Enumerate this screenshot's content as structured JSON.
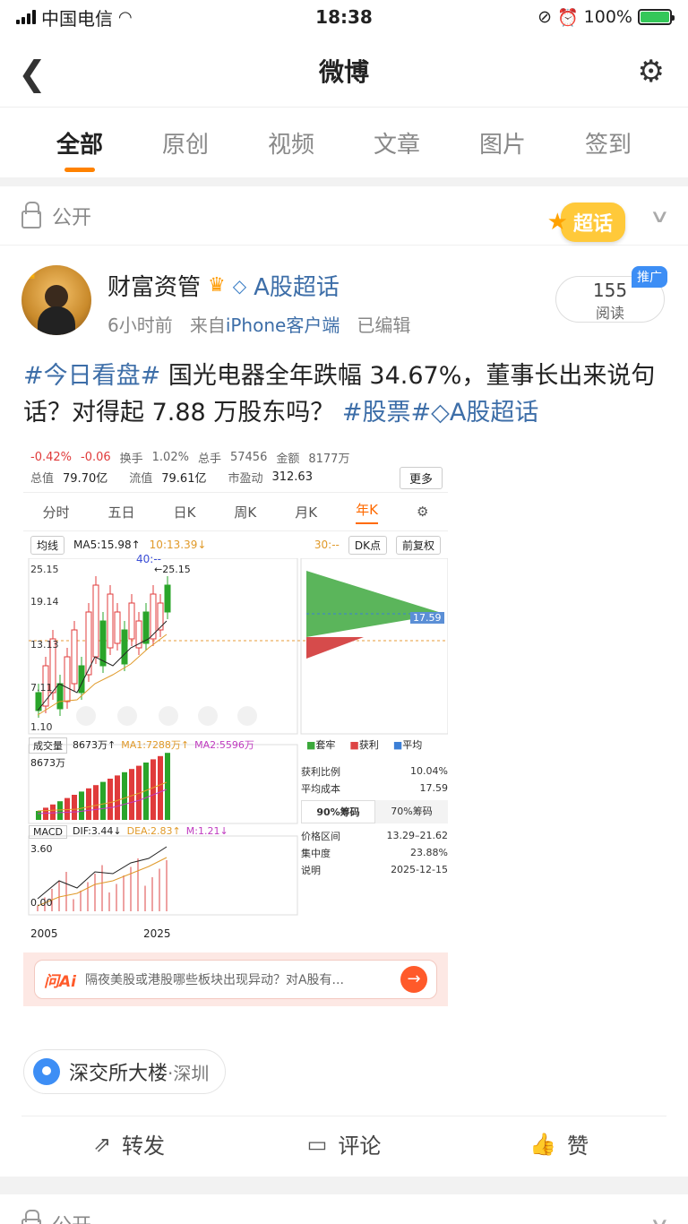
{
  "status": {
    "carrier": "中国电信",
    "time": "18:38",
    "battery": "100%"
  },
  "nav": {
    "title": "微博"
  },
  "tabs": [
    "全部",
    "原创",
    "视频",
    "文章",
    "图片",
    "签到"
  ],
  "visibility": {
    "label": "公开",
    "badge": "超话"
  },
  "post": {
    "author": "财富资管",
    "topic": "A股超话",
    "time": "6小时前",
    "from_prefix": "来自",
    "client": "iPhone客户端",
    "edited": "已编辑",
    "reads": "155",
    "reads_label": "阅读",
    "promo": "推广",
    "text_hash1": "#今日看盘#",
    "text_body": " 国光电器全年跌幅 34.67%，董事长出来说句话？对得起 7.88 万股东吗？",
    "text_hash2": "#股票#",
    "text_hash3": "A股超话"
  },
  "stock": {
    "row1": [
      "-0.42%",
      "-0.06",
      "换手",
      "1.02%",
      "总手",
      "57456",
      "金额",
      "8177万"
    ],
    "total_value_label": "总值",
    "total_value": "79.70亿",
    "float_label": "流值",
    "float_value": "79.61亿",
    "pe_label": "市盈动",
    "pe_value": "312.63",
    "more": "更多",
    "ktabs": [
      "分时",
      "五日",
      "日K",
      "周K",
      "月K",
      "年K"
    ],
    "ma_select": "均线",
    "ma5": "MA5:15.98↑",
    "ma10": "10:13.39↓",
    "ma30": "30:--",
    "ma40": "40:--",
    "dk": "DK点",
    "fq": "前复权",
    "y_labels": [
      "25.15",
      "19.14",
      "13.13",
      "7.11",
      "1.10"
    ],
    "high_label": "25.15",
    "cost_price": "17.59",
    "vol_select": "成交量",
    "vol_value": "8673万↑",
    "vol_ma1": "MA1:7288万↑",
    "vol_ma2": "MA2:5596万",
    "vol_axis": "8673万",
    "legend": [
      "套牢",
      "获利",
      "平均"
    ],
    "macd_select": "MACD",
    "dif": "DIF:3.44↓",
    "dea": "DEA:2.83↑",
    "m": "M:1.21↓",
    "macd_axis": "3.60",
    "macd_axis0": "0.00",
    "x_start": "2005",
    "x_end": "2025",
    "stats": [
      {
        "k": "获利比例",
        "v": "10.04%"
      },
      {
        "k": "平均成本",
        "v": "17.59"
      }
    ],
    "chip_tabs": [
      "90%筹码",
      "70%筹码"
    ],
    "stats2": [
      {
        "k": "价格区间",
        "v": "13.29–21.62"
      },
      {
        "k": "集中度",
        "v": "23.88%"
      },
      {
        "k": "说明",
        "v": "2025-12-15"
      }
    ],
    "ai_logo": "问Ai",
    "ai_text": "隔夜美股或港股哪些板块出现异动？对A股有..."
  },
  "location": {
    "name": "深交所大楼",
    "city": "·深圳"
  },
  "actions": {
    "repost": "转发",
    "comment": "评论",
    "like": "赞"
  },
  "next": {
    "label": "公开"
  },
  "colors": {
    "accent": "#ff8200",
    "link": "#3d6ea8",
    "up": "#e03b3b",
    "down": "#2aa52a"
  }
}
